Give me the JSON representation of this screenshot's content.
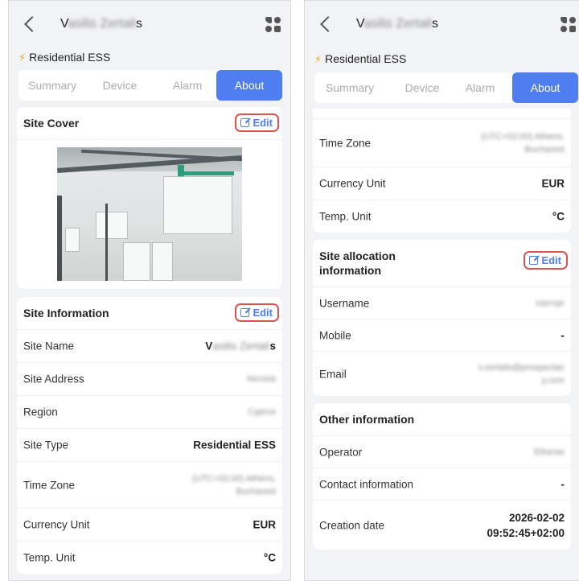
{
  "left": {
    "header": {
      "title_prefix": "V",
      "title_blurred": "asilis Zertali",
      "title_suffix": "s"
    },
    "site_type_line": "Residential ESS",
    "tabs": [
      "Summary",
      "Device",
      "Alarm",
      "About"
    ],
    "active_tab": "About",
    "site_cover": {
      "title": "Site Cover",
      "edit_label": "Edit"
    },
    "site_information": {
      "title": "Site Information",
      "edit_label": "Edit",
      "rows": [
        {
          "label": "Site Name",
          "value_prefix": "V",
          "value_blurred": "asilis Zertali",
          "value_suffix": "s"
        },
        {
          "label": "Site Address",
          "value": "Nicosia"
        },
        {
          "label": "Region",
          "value": "Cyprus"
        },
        {
          "label": "Site Type",
          "value": "Residential ESS"
        },
        {
          "label": "Time Zone",
          "value_line1": "(UTC+02:00) Athens,",
          "value_line2": "Bucharest"
        },
        {
          "label": "Currency Unit",
          "value": "EUR"
        },
        {
          "label": "Temp. Unit",
          "value": "°C"
        }
      ]
    }
  },
  "right": {
    "header": {
      "title_prefix": "V",
      "title_blurred": "asilis Zertali",
      "title_suffix": "s"
    },
    "site_type_line": "Residential ESS",
    "tabs": [
      "Summary",
      "Device",
      "Alarm",
      "About"
    ],
    "active_tab": "About",
    "top_rows": [
      {
        "label": "Time Zone",
        "value_line1": "(UTC+02:00) Athens,",
        "value_line2": "Bucharest"
      },
      {
        "label": "Currency Unit",
        "value": "EUR"
      },
      {
        "label": "Temp. Unit",
        "value": "°C"
      }
    ],
    "site_allocation": {
      "title_line1": "Site allocation",
      "title_line2": "information",
      "edit_label": "Edit",
      "rows": [
        {
          "label": "Username",
          "value": "vazmpr"
        },
        {
          "label": "Mobile",
          "value": "-"
        },
        {
          "label": "Email",
          "value_line1": "v.zertalis@prospectac",
          "value_line2": "y.com"
        }
      ]
    },
    "other_information": {
      "title": "Other information",
      "rows": [
        {
          "label": "Operator",
          "value": "Etheras"
        },
        {
          "label": "Contact information",
          "value": "-"
        },
        {
          "label": "Creation date",
          "value_line1": "2026-02-02",
          "value_line2": "09:52:45+02:00"
        }
      ]
    }
  },
  "colors": {
    "accent": "#4f7ef0",
    "highlight_border": "#d9534f",
    "bolt": "#f5a623"
  }
}
